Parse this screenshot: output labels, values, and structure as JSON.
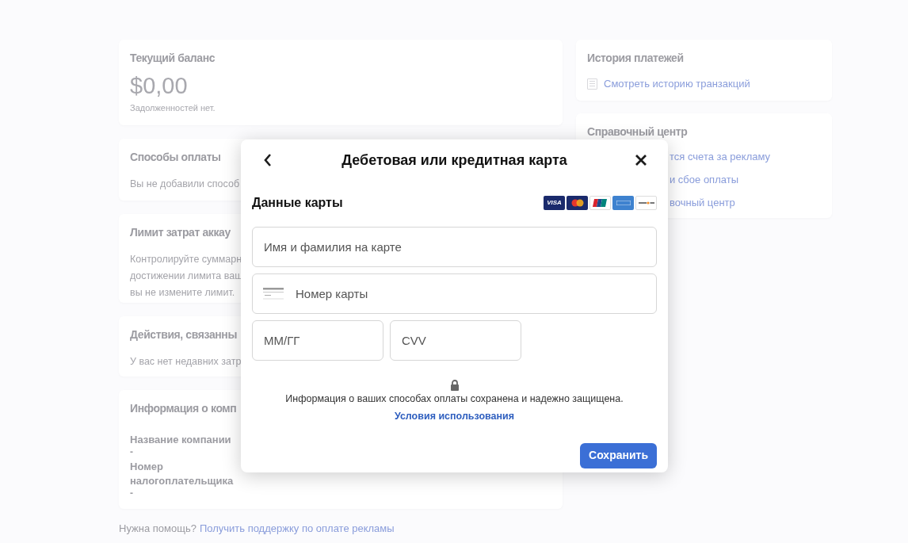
{
  "background": {
    "balance": {
      "title": "Текущий баланс",
      "amount": "$0,00",
      "note": "Задолженностей нет."
    },
    "payment_methods": {
      "title": "Способы оплаты",
      "text": "Вы не добавили способ"
    },
    "spending_limit": {
      "title": "Лимит затрат аккау",
      "lines": [
        "Контролируйте суммарн",
        "достижении лимита ваш",
        "вы не измените лимит."
      ]
    },
    "activity": {
      "title": "Действия, связанны",
      "text": "У вас нет недавних затр"
    },
    "company": {
      "title": "Информация о комп",
      "fields": [
        {
          "label": "Название компании",
          "value": "-"
        },
        {
          "label": "Номер налогоплательщика",
          "value": "-"
        }
      ]
    },
    "payment_history": {
      "title": "История платежей",
      "link": "Смотреть историю транзакций"
    },
    "help_center": {
      "title": "Справочный центр",
      "links": [
        "тся счета за рекламу",
        "и сбое оплаты",
        "вочный центр"
      ]
    },
    "footer": {
      "text": "Нужна помощь?",
      "link": "Получить поддержку по оплате рекламы"
    }
  },
  "modal": {
    "title": "Дебетовая или кредитная карта",
    "section_title": "Данные карты",
    "brands": [
      {
        "kind": "visa",
        "label": "VISA"
      },
      {
        "kind": "mastercard"
      },
      {
        "kind": "unionpay"
      },
      {
        "kind": "amex"
      },
      {
        "kind": "discover"
      }
    ],
    "fields": [
      {
        "kind": "name",
        "placeholder": "Имя и фамилия на карте"
      },
      {
        "kind": "number",
        "placeholder": "Номер карты"
      },
      {
        "kind": "expiry",
        "placeholder": "ММ/ГГ"
      },
      {
        "kind": "cvv",
        "placeholder": "CVV"
      }
    ],
    "security_note": "Информация о ваших способах оплаты сохранена и надежно защищена.",
    "terms_link": "Условия использования",
    "save_button": "Сохранить"
  }
}
